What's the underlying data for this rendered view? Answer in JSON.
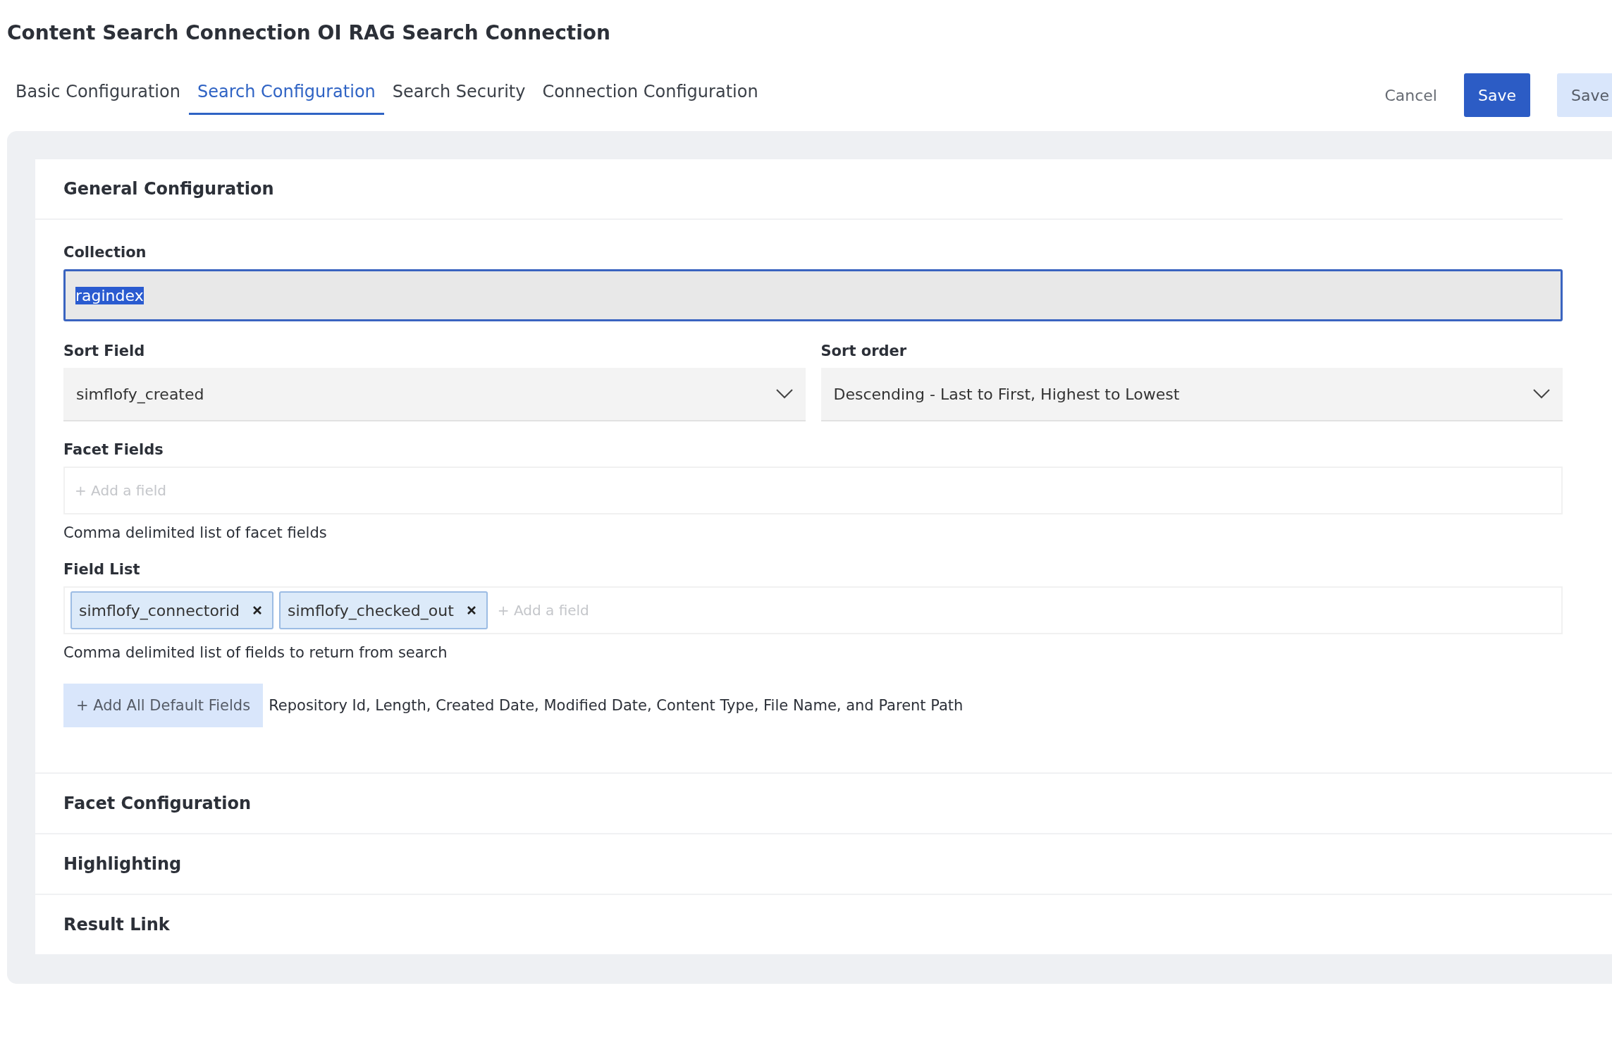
{
  "title": "Content Search Connection OI RAG Search Connection",
  "tabs": [
    {
      "label": "Basic Configuration",
      "selected": false
    },
    {
      "label": "Search Configuration",
      "selected": true
    },
    {
      "label": "Search Security",
      "selected": false
    },
    {
      "label": "Connection Configuration",
      "selected": false
    }
  ],
  "actions": [
    {
      "label": "Cancel",
      "kind": "text"
    },
    {
      "label": "Save",
      "kind": "primary"
    },
    {
      "label": "Save",
      "kind": "secondary"
    }
  ],
  "sections": [
    {
      "title": "General Configuration",
      "expanded": true,
      "fields": [
        {
          "kind": "text",
          "label": "Collection",
          "value": "ragindex",
          "focused": true,
          "highlighted": true
        },
        {
          "kind": "selects",
          "items": [
            {
              "label": "Sort Field",
              "value": "simflofy_created"
            },
            {
              "label": "Sort order",
              "value": "Descending - Last to First, Highest to Lowest"
            }
          ]
        },
        {
          "kind": "tags",
          "label": "Facet Fields",
          "placeholder": "+ Add a field",
          "help": "Comma delimited list of facet fields"
        },
        {
          "kind": "tags",
          "label": "Field List",
          "tags": [
            "simflofy_connectorid",
            "simflofy_checked_out"
          ],
          "placeholder": "+ Add a field",
          "help": "Comma delimited list of fields to return from search"
        },
        {
          "kind": "action",
          "button": "+ Add All Default Fields",
          "note": "Repository Id, Length, Created Date, Modified Date, Content Type, File Name, and Parent Path"
        }
      ]
    },
    {
      "title": "Facet Configuration",
      "expanded": false
    },
    {
      "title": "Highlighting",
      "expanded": false
    },
    {
      "title": "Result Link",
      "expanded": false
    }
  ]
}
